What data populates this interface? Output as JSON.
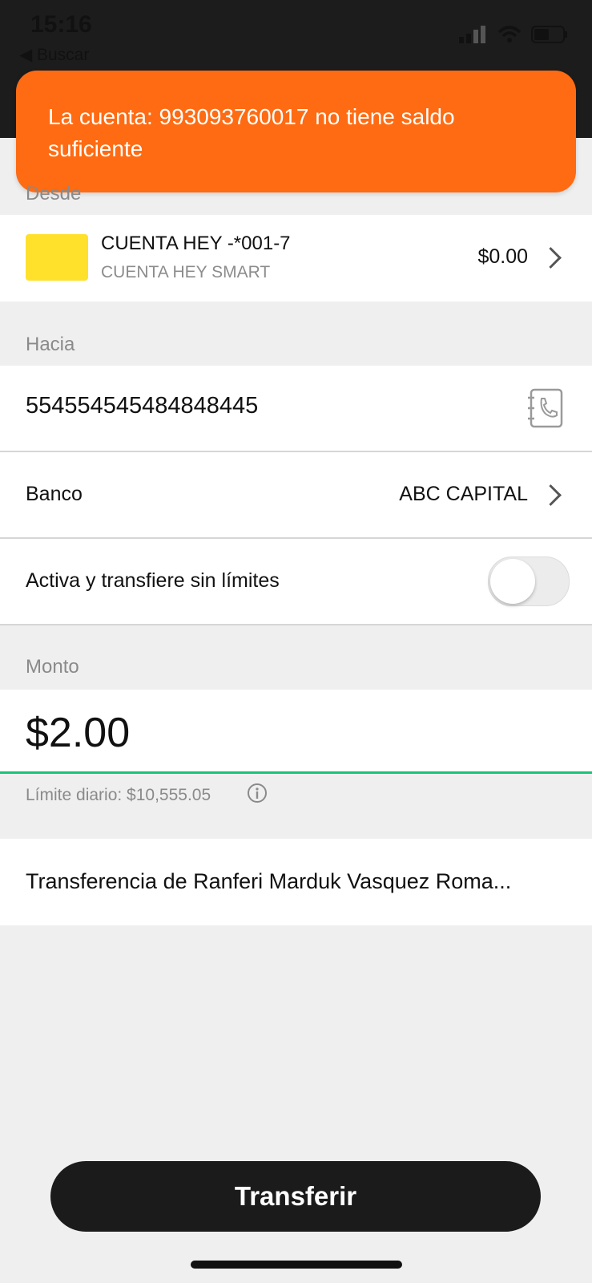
{
  "status_bar": {
    "time": "15:16",
    "back_label": "◀ Buscar"
  },
  "toast": {
    "message": "La cuenta: 993093760017 no tiene saldo suficiente"
  },
  "desde": {
    "label": "Desde",
    "account_name": "CUENTA HEY -*001-7",
    "account_type": "CUENTA HEY SMART",
    "balance": "$0.00",
    "card_color": "#ffe12c"
  },
  "hacia": {
    "label": "Hacia",
    "account_number": "554554545484848445",
    "contacts_icon": "contacts-book-icon"
  },
  "banco": {
    "label": "Banco",
    "value": "ABC CAPITAL"
  },
  "unlimited": {
    "label": "Activa y transfiere sin límites",
    "enabled": false
  },
  "monto": {
    "label": "Monto",
    "value": "$2.00",
    "daily_limit": "Límite diario: $10,555.05",
    "underline_color": "#19c27a"
  },
  "concepto": {
    "value": "Transferencia de Ranferi Marduk Vasquez Roma..."
  },
  "actions": {
    "transfer_label": "Transferir"
  },
  "colors": {
    "accent_toast": "#ff6b12",
    "button_bg": "#1b1b1b"
  }
}
